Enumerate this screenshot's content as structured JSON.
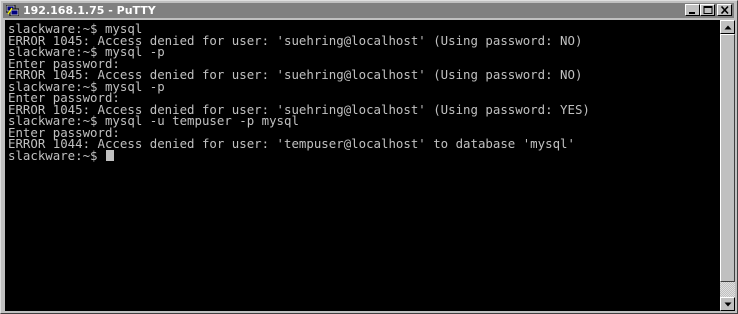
{
  "window": {
    "title": "192.168.1.75 - PuTTY",
    "app_icon": "putty-icon",
    "buttons": {
      "minimize": "minimize-icon",
      "maximize": "maximize-icon",
      "close": "close-icon"
    }
  },
  "terminal": {
    "lines": [
      "slackware:~$ mysql",
      "ERROR 1045: Access denied for user: 'suehring@localhost' (Using password: NO)",
      "slackware:~$ mysql -p",
      "Enter password:",
      "ERROR 1045: Access denied for user: 'suehring@localhost' (Using password: NO)",
      "slackware:~$ mysql -p",
      "Enter password:",
      "ERROR 1045: Access denied for user: 'suehring@localhost' (Using password: YES)",
      "slackware:~$ mysql -u tempuser -p mysql",
      "Enter password:",
      "ERROR 1044: Access denied for user: 'tempuser@localhost' to database 'mysql'"
    ],
    "current_prompt": "slackware:~$ ",
    "colors": {
      "background": "#000000",
      "foreground": "#c0c0c0"
    }
  },
  "scrollbar": {
    "up_icon": "scroll-up-arrow-icon",
    "down_icon": "scroll-down-arrow-icon"
  }
}
